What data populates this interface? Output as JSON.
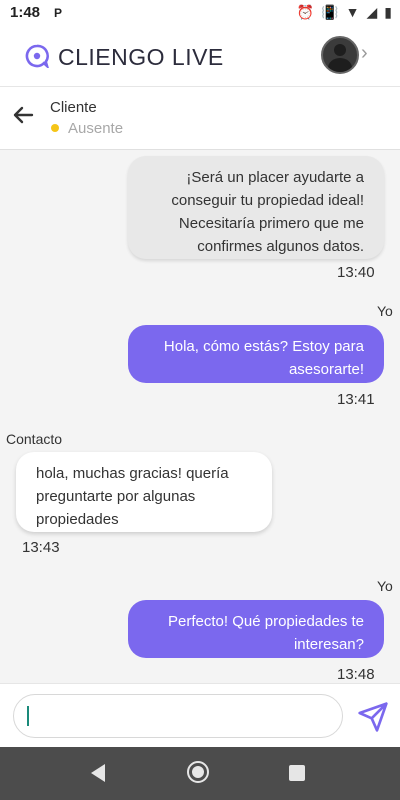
{
  "status_bar": {
    "time": "1:48",
    "parking_icon": "P",
    "icons": [
      "alarm-icon",
      "vibrate-icon",
      "wifi-icon",
      "signal-icon",
      "battery-icon"
    ]
  },
  "app": {
    "title": "CLIENGO LIVE",
    "brand_color": "#7b68ee"
  },
  "contact": {
    "name": "Cliente",
    "status": "Ausente",
    "status_color": "#f5c518"
  },
  "messages": [
    {
      "sender": "",
      "direction": "in",
      "text": "¡Será un placer ayudarte a conseguir tu propiedad ideal! Necesitaría primero que me confirmes algunos datos.",
      "time": "13:40"
    },
    {
      "sender": "Yo",
      "direction": "out",
      "text": "Hola, cómo estás? Estoy para asesorarte!",
      "time": "13:41"
    },
    {
      "sender": "Contacto",
      "direction": "in",
      "text": "hola, muchas gracias! quería preguntarte por algunas propiedades",
      "time": "13:43"
    },
    {
      "sender": "Yo",
      "direction": "out",
      "text": "Perfecto! Qué propiedades te interesan?",
      "time": "13:48"
    }
  ],
  "composer": {
    "value": "",
    "placeholder": ""
  }
}
